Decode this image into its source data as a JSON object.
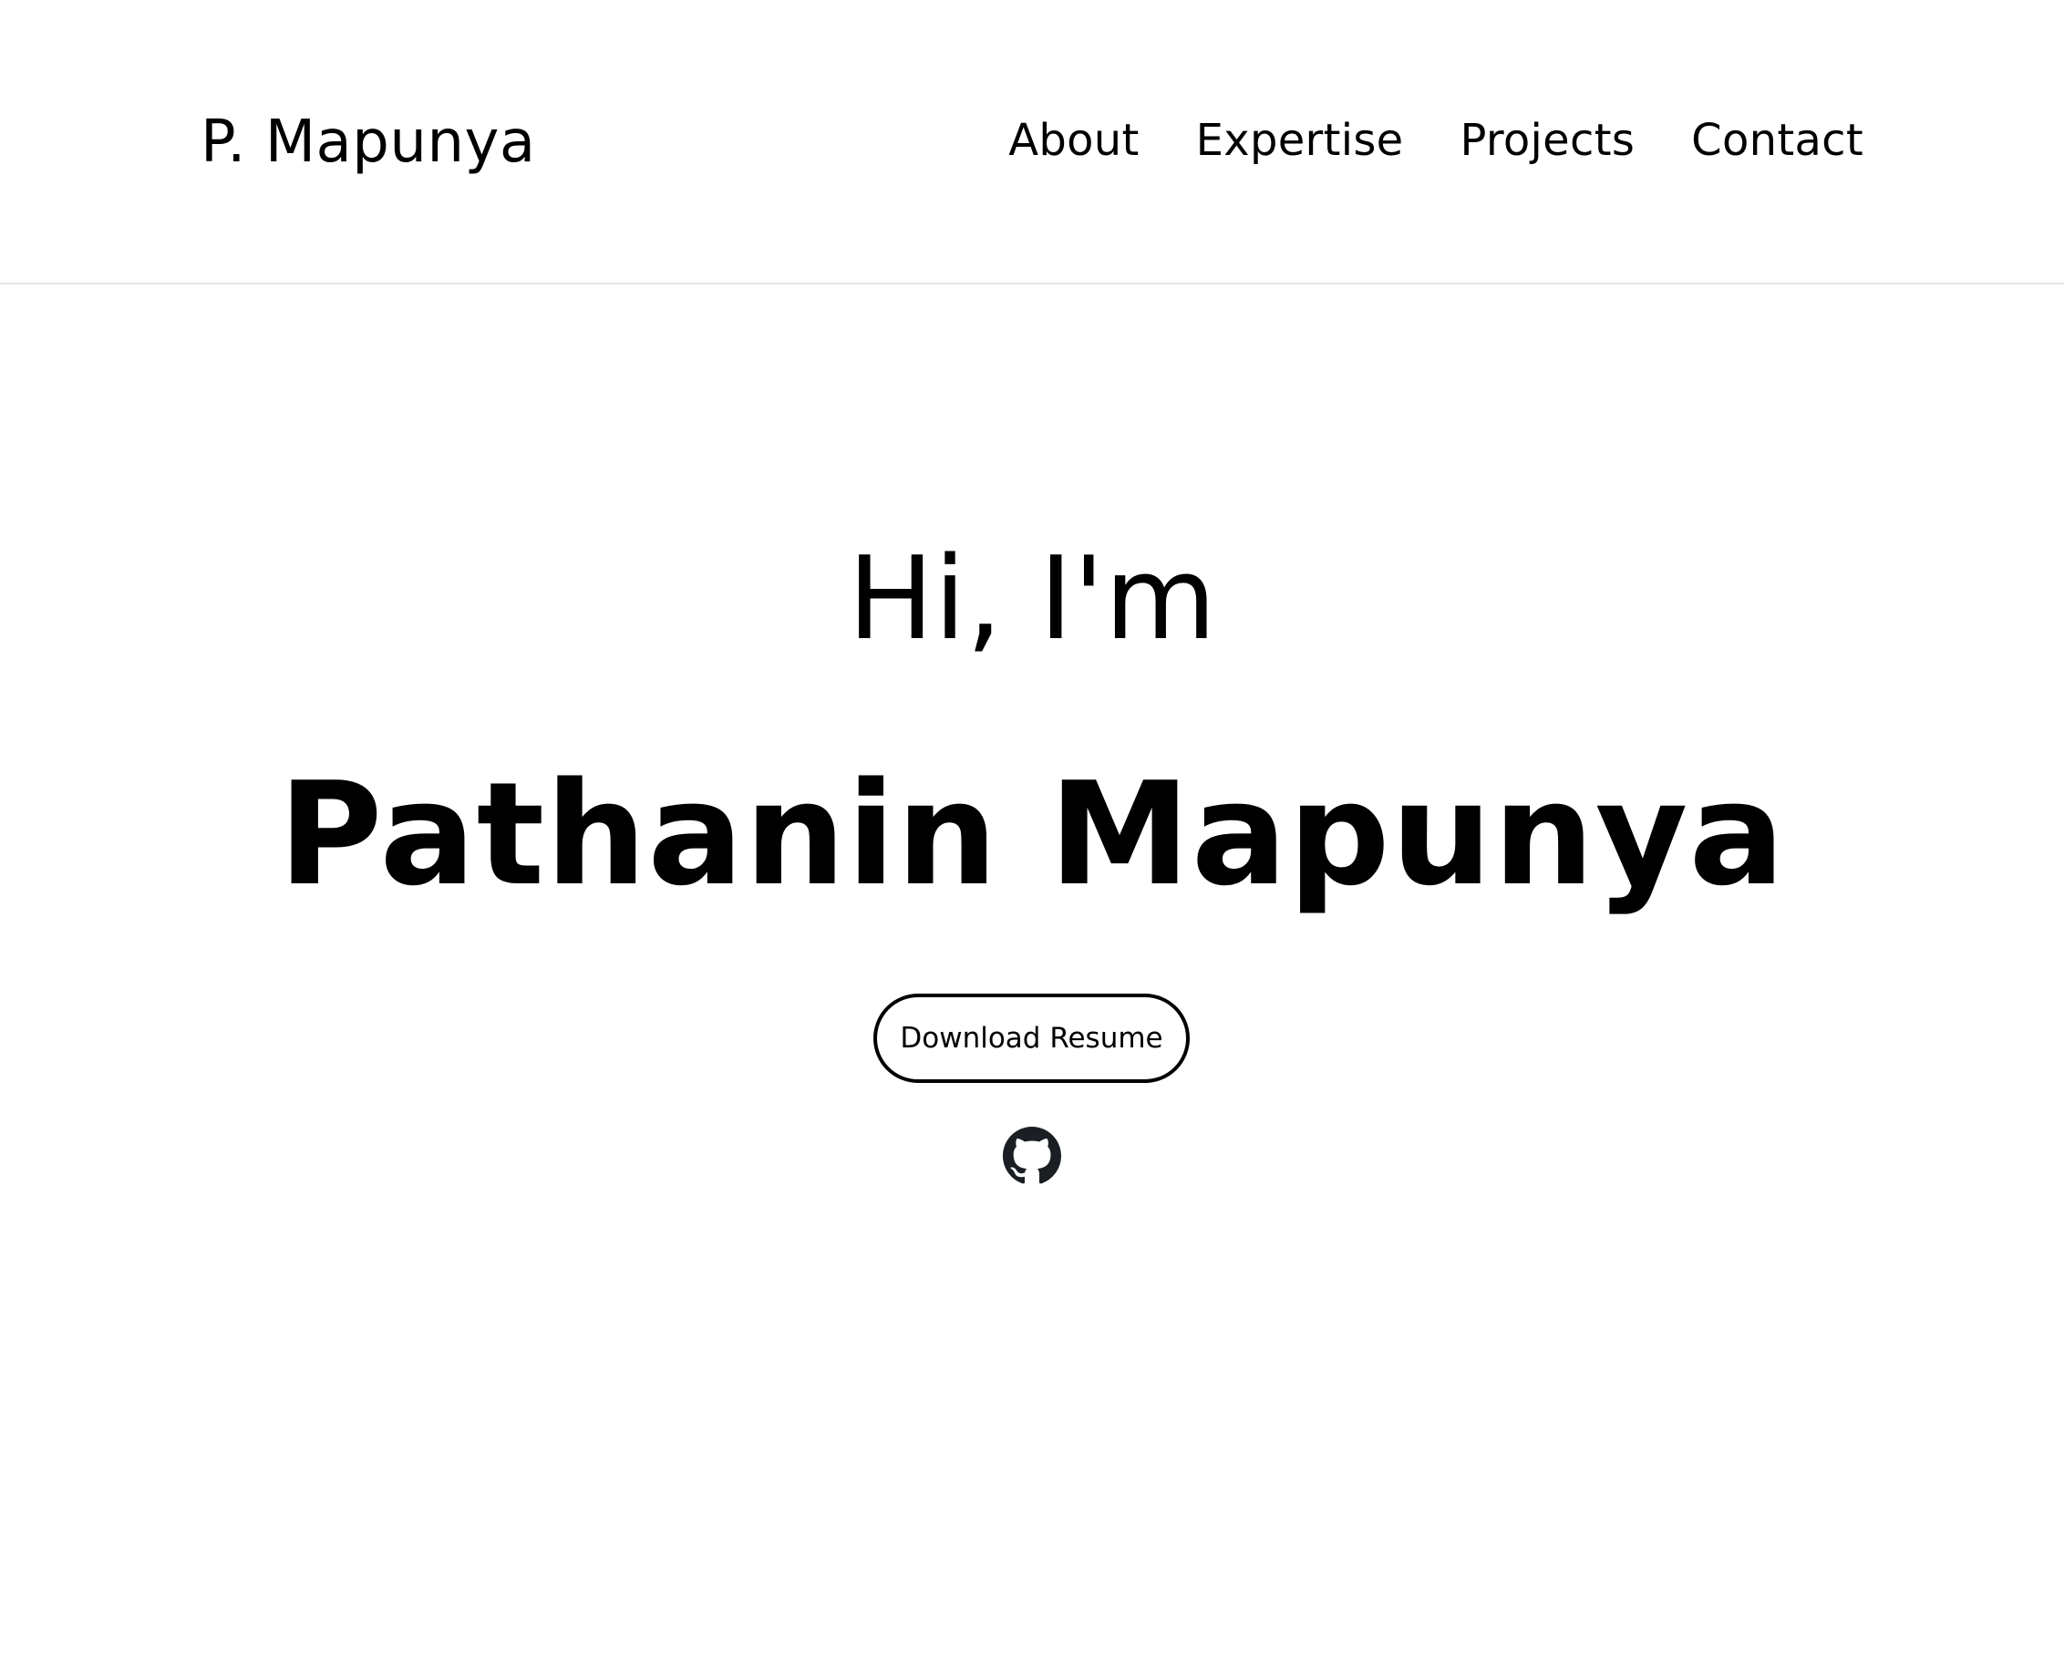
{
  "header": {
    "brand": "P. Mapunya",
    "nav": [
      {
        "label": "About"
      },
      {
        "label": "Expertise"
      },
      {
        "label": "Projects"
      },
      {
        "label": "Contact"
      }
    ]
  },
  "hero": {
    "greeting": "Hi, I'm",
    "name": "Pathanin Mapunya",
    "resume_button": "Download Resume",
    "social": [
      {
        "icon": "github-icon",
        "aria_label": "GitHub"
      }
    ]
  },
  "colors": {
    "text": "#000000",
    "background": "#ffffff",
    "divider": "#e3e6ec",
    "icon": "#1b1f23"
  }
}
